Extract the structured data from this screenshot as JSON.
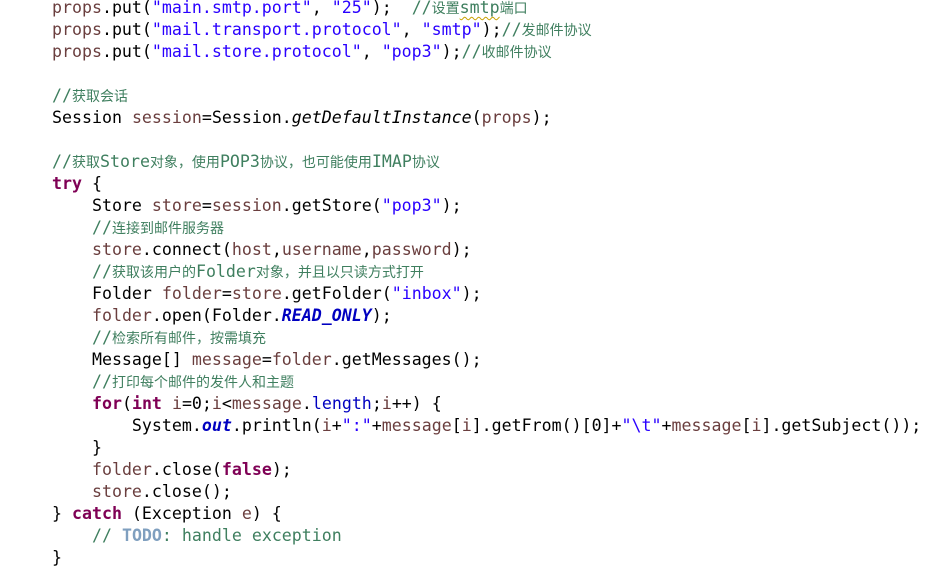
{
  "editor": {
    "language": "java",
    "colors": {
      "background": "#ffffff",
      "keyword": "#7f0055",
      "string": "#2a00ff",
      "comment": "#3f7f5f",
      "todo": "#7f9fbf",
      "variable": "#6a3e3e",
      "field": "#0000c0"
    },
    "lines": [
      {
        "tokens": [
          {
            "t": "props",
            "c": "var"
          },
          {
            "t": ".put("
          },
          {
            "t": "\"main.smtp.port\"",
            "c": "str"
          },
          {
            "t": ", "
          },
          {
            "t": "\"25\"",
            "c": "str"
          },
          {
            "t": ");  "
          },
          {
            "t": "//设置",
            "c": "cmt"
          },
          {
            "t": "smtp",
            "c": "cmt squiggle"
          },
          {
            "t": "端口",
            "c": "cmt"
          }
        ]
      },
      {
        "tokens": [
          {
            "t": "props",
            "c": "var"
          },
          {
            "t": ".put("
          },
          {
            "t": "\"mail.transport.protocol\"",
            "c": "str"
          },
          {
            "t": ", "
          },
          {
            "t": "\"smtp\"",
            "c": "str"
          },
          {
            "t": ");"
          },
          {
            "t": "//发邮件协议",
            "c": "cmt"
          }
        ]
      },
      {
        "tokens": [
          {
            "t": "props",
            "c": "var"
          },
          {
            "t": ".put("
          },
          {
            "t": "\"mail.store.protocol\"",
            "c": "str"
          },
          {
            "t": ", "
          },
          {
            "t": "\"pop3\"",
            "c": "str"
          },
          {
            "t": ");"
          },
          {
            "t": "//收邮件协议",
            "c": "cmt"
          }
        ]
      },
      {
        "tokens": []
      },
      {
        "tokens": [
          {
            "t": "//获取会话",
            "c": "cmt"
          }
        ]
      },
      {
        "tokens": [
          {
            "t": "Session "
          },
          {
            "t": "session",
            "c": "var"
          },
          {
            "t": "=Session."
          },
          {
            "t": "getDefaultInstance",
            "c": "italic"
          },
          {
            "t": "("
          },
          {
            "t": "props",
            "c": "var"
          },
          {
            "t": ");"
          }
        ]
      },
      {
        "tokens": []
      },
      {
        "tokens": [
          {
            "t": "//获取Store对象，使用POP3协议，也可能使用IMAP协议",
            "c": "cmt"
          }
        ]
      },
      {
        "tokens": [
          {
            "t": "try",
            "c": "kw"
          },
          {
            "t": " {"
          }
        ]
      },
      {
        "tokens": [
          {
            "t": "    Store "
          },
          {
            "t": "store",
            "c": "var"
          },
          {
            "t": "="
          },
          {
            "t": "session",
            "c": "var"
          },
          {
            "t": ".getStore("
          },
          {
            "t": "\"pop3\"",
            "c": "str"
          },
          {
            "t": ");"
          }
        ]
      },
      {
        "tokens": [
          {
            "t": "    "
          },
          {
            "t": "//连接到邮件服务器",
            "c": "cmt"
          }
        ]
      },
      {
        "tokens": [
          {
            "t": "    "
          },
          {
            "t": "store",
            "c": "var"
          },
          {
            "t": ".connect("
          },
          {
            "t": "host",
            "c": "var"
          },
          {
            "t": ","
          },
          {
            "t": "username",
            "c": "var"
          },
          {
            "t": ","
          },
          {
            "t": "password",
            "c": "var"
          },
          {
            "t": ");"
          }
        ]
      },
      {
        "tokens": [
          {
            "t": "    "
          },
          {
            "t": "//获取该用户的Folder对象，并且以只读方式打开",
            "c": "cmt"
          }
        ]
      },
      {
        "tokens": [
          {
            "t": "    Folder "
          },
          {
            "t": "folder",
            "c": "var"
          },
          {
            "t": "="
          },
          {
            "t": "store",
            "c": "var"
          },
          {
            "t": ".getFolder("
          },
          {
            "t": "\"inbox\"",
            "c": "str"
          },
          {
            "t": ");"
          }
        ]
      },
      {
        "tokens": [
          {
            "t": "    "
          },
          {
            "t": "folder",
            "c": "var"
          },
          {
            "t": ".open(Folder."
          },
          {
            "t": "READ_ONLY",
            "c": "static"
          },
          {
            "t": ");"
          }
        ]
      },
      {
        "tokens": [
          {
            "t": "    "
          },
          {
            "t": "//检索所有邮件，按需填充",
            "c": "cmt"
          }
        ]
      },
      {
        "tokens": [
          {
            "t": "    Message[] "
          },
          {
            "t": "message",
            "c": "var"
          },
          {
            "t": "="
          },
          {
            "t": "folder",
            "c": "var"
          },
          {
            "t": ".getMessages();"
          }
        ]
      },
      {
        "tokens": [
          {
            "t": "    "
          },
          {
            "t": "//打印每个邮件的发件人和主题",
            "c": "cmt"
          }
        ]
      },
      {
        "tokens": [
          {
            "t": "    "
          },
          {
            "t": "for",
            "c": "kw"
          },
          {
            "t": "("
          },
          {
            "t": "int",
            "c": "kw"
          },
          {
            "t": " "
          },
          {
            "t": "i",
            "c": "var"
          },
          {
            "t": "=0;"
          },
          {
            "t": "i",
            "c": "var"
          },
          {
            "t": "<"
          },
          {
            "t": "message",
            "c": "var"
          },
          {
            "t": "."
          },
          {
            "t": "length",
            "c": "field"
          },
          {
            "t": ";"
          },
          {
            "t": "i",
            "c": "var"
          },
          {
            "t": "++) {"
          }
        ]
      },
      {
        "tokens": [
          {
            "t": "        System."
          },
          {
            "t": "out",
            "c": "static"
          },
          {
            "t": ".println("
          },
          {
            "t": "i",
            "c": "var"
          },
          {
            "t": "+"
          },
          {
            "t": "\":\"",
            "c": "str"
          },
          {
            "t": "+"
          },
          {
            "t": "message",
            "c": "var"
          },
          {
            "t": "["
          },
          {
            "t": "i",
            "c": "var"
          },
          {
            "t": "].getFrom()[0]+"
          },
          {
            "t": "\"\\t\"",
            "c": "str"
          },
          {
            "t": "+"
          },
          {
            "t": "message",
            "c": "var"
          },
          {
            "t": "["
          },
          {
            "t": "i",
            "c": "var"
          },
          {
            "t": "].getSubject());"
          }
        ]
      },
      {
        "tokens": [
          {
            "t": "    }"
          }
        ]
      },
      {
        "tokens": [
          {
            "t": "    "
          },
          {
            "t": "folder",
            "c": "var"
          },
          {
            "t": ".close("
          },
          {
            "t": "false",
            "c": "kw"
          },
          {
            "t": ");"
          }
        ]
      },
      {
        "tokens": [
          {
            "t": "    "
          },
          {
            "t": "store",
            "c": "var"
          },
          {
            "t": ".close();"
          }
        ]
      },
      {
        "tokens": [
          {
            "t": "} "
          },
          {
            "t": "catch",
            "c": "kw"
          },
          {
            "t": " (Exception "
          },
          {
            "t": "e",
            "c": "var"
          },
          {
            "t": ") {"
          }
        ]
      },
      {
        "tokens": [
          {
            "t": "    "
          },
          {
            "t": "// ",
            "c": "cmt"
          },
          {
            "t": "TODO",
            "c": "todo"
          },
          {
            "t": ": handle exception",
            "c": "cmt"
          }
        ]
      },
      {
        "tokens": [
          {
            "t": "}"
          }
        ]
      }
    ]
  }
}
